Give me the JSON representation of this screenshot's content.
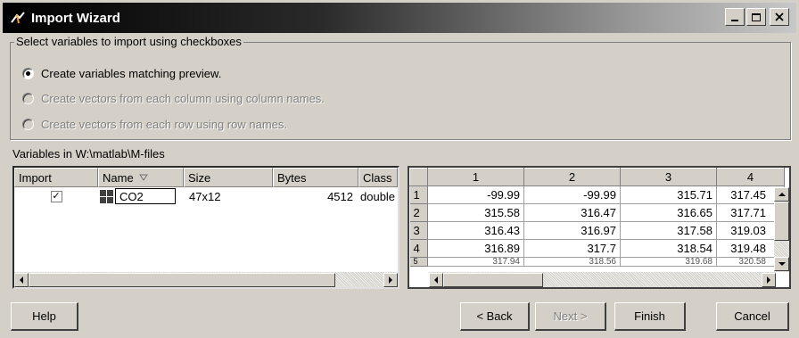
{
  "window": {
    "title": "Import Wizard"
  },
  "options_group": {
    "legend": "Select variables to import using checkboxes",
    "options": [
      {
        "label": "Create variables matching preview.",
        "checked": true,
        "enabled": true
      },
      {
        "label": "Create vectors from each column using column names.",
        "checked": false,
        "enabled": false
      },
      {
        "label": "Create vectors from each row using row names.",
        "checked": false,
        "enabled": false
      }
    ]
  },
  "variables_label": "Variables in W:\\matlab\\M-files",
  "variables_table": {
    "columns": [
      "Import",
      "Name",
      "Size",
      "Bytes",
      "Class"
    ],
    "rows": [
      {
        "import_checked": true,
        "import_mark": "✓",
        "name": "CO2",
        "size": "47x12",
        "bytes": "4512",
        "class": "double"
      }
    ]
  },
  "preview_table": {
    "columns": [
      "1",
      "2",
      "3",
      "4"
    ],
    "row_headers": [
      "1",
      "2",
      "3",
      "4",
      "5"
    ],
    "rows": [
      [
        "-99.99",
        "-99.99",
        "315.71",
        "317.45"
      ],
      [
        "315.58",
        "316.47",
        "316.65",
        "317.71"
      ],
      [
        "316.43",
        "316.97",
        "317.58",
        "319.03"
      ],
      [
        "316.89",
        "317.7",
        "318.54",
        "319.48"
      ],
      [
        "317.94",
        "318.56",
        "319.68",
        "320.58"
      ]
    ]
  },
  "buttons": {
    "help": "Help",
    "back": "< Back",
    "next": "Next >",
    "finish": "Finish",
    "cancel": "Cancel"
  }
}
